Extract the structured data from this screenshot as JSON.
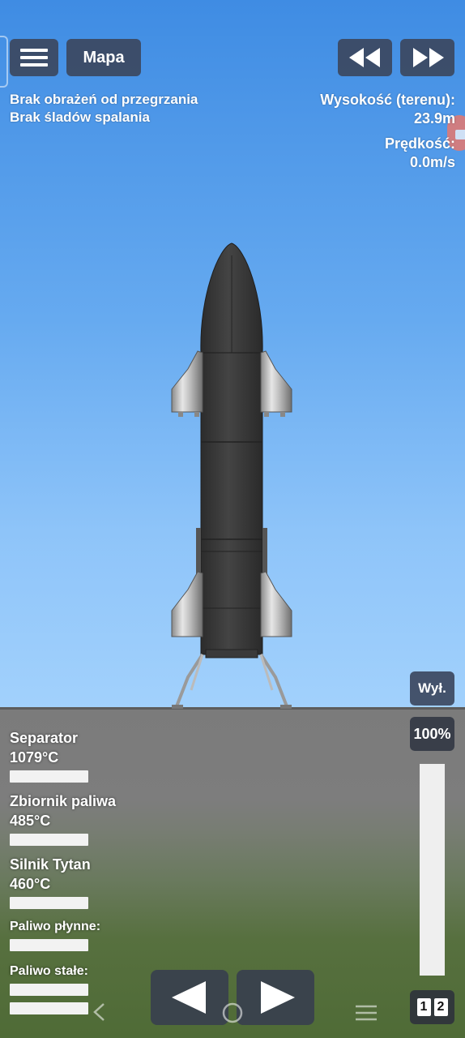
{
  "top_bar": {
    "map_label": "Mapa",
    "menu_icon": "hamburger-menu-icon",
    "rewind_icon": "rewind-icon",
    "fast_forward_icon": "fast-forward-icon"
  },
  "status": {
    "line1": "Brak obrażeń od przegrzania",
    "line2": "Brak śladów spalania"
  },
  "telemetry": {
    "altitude_label": "Wysokość (terenu):",
    "altitude_value": "23.9m",
    "speed_label": "Prędkość:",
    "speed_value": "0.0m/s"
  },
  "temperatures": [
    {
      "label": "Separator 1079°C"
    },
    {
      "label": "Zbiornik paliwa 485°C"
    },
    {
      "label": "Silnik Tytan 460°C"
    }
  ],
  "fuel": {
    "liquid_label": "Paliwo płynne:",
    "solid_label": "Paliwo stałe:"
  },
  "controls": {
    "engine_toggle_label": "Wył.",
    "throttle_percent": "100%",
    "throttle_level": 1.0,
    "stage_digit_1": "1",
    "stage_digit_2": "2"
  },
  "colors": {
    "sky_top": "#3f8ce3",
    "sky_bottom": "#a2d1fc",
    "ground": "#7b7b7b",
    "grass": "#4f6b36",
    "button_bg": "#3c485f",
    "rocket_body": "#3a3a3a"
  }
}
